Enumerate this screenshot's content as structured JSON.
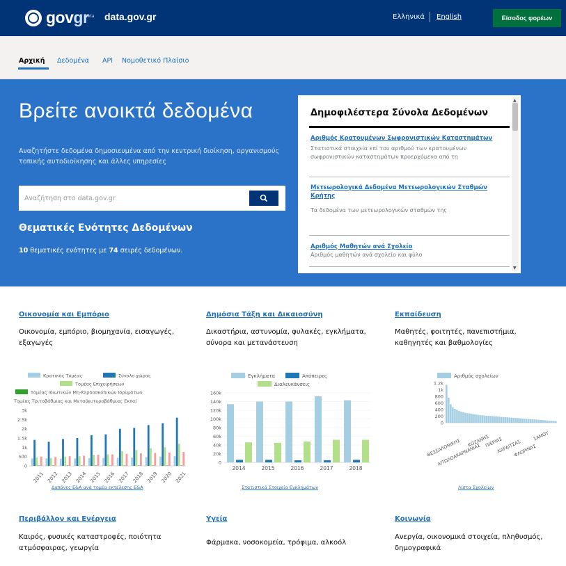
{
  "header": {
    "logo_text": "gov",
    "logo_text_accent": "gr",
    "logo_beta": "beta",
    "site_name": "data.gov.gr",
    "lang_el": "Ελληνικά",
    "lang_en": "English",
    "login_label": "Είσοδος φορέων",
    "colors": {
      "bar": "#003476",
      "login": "#00703c"
    }
  },
  "nav": {
    "items": [
      {
        "label": "Αρχική",
        "active": true
      },
      {
        "label": "Δεδομένα",
        "active": false
      },
      {
        "label": "API",
        "active": false
      },
      {
        "label": "Νομοθετικό Πλαίσιο",
        "active": false
      }
    ]
  },
  "hero": {
    "title": "Βρείτε ανοικτά δεδομένα",
    "description": "Αναζητήστε δεδομένα δημοσιευμένα από την κεντρική διοίκηση, οργανισμούς τοπικής αυτοδιοίκησης και άλλες υπηρεσίες",
    "search_placeholder": "Αναζήτηση στο data.gov.gr",
    "search_icon": "search-icon",
    "themes_title": "Θεματικές Ενότητες Δεδομένων",
    "themes_count": "10",
    "themes_text_1": "θεματικές ενότητες με",
    "series_count": "74",
    "themes_text_2": "σειρές δεδομένων.",
    "color": "#2b72c9"
  },
  "popular": {
    "title": "Δημοφιλέστερα Σύνολα Δεδομένων",
    "items": [
      {
        "title": "Αριθμός Κρατουμένων Σωφρονιστικών Καταστημάτων",
        "desc": "Στατιστικά στοιχεία επί του αριθμού των κρατουμένων σωφρονιστικών καταστημάτων προερχόμενα από τη"
      },
      {
        "title": "Μετεωρολογικά Δεδομένα Μετεωρολογικών Σταθμών Κρήτης",
        "desc": "Τα δεδομένα των μετεωρολογικών σταθμών της"
      },
      {
        "title": "Αριθμός Μαθητών ανά Σχολείο",
        "desc": "Αριθμός μαθητών ανά σχολείο και φύλο"
      }
    ]
  },
  "categories": [
    {
      "title": "Οικονομία και Εμπόριο",
      "desc": "Οικονομία, εμπόριο, βιομηχανία, εισαγωγές, εξαγωγές",
      "chart_link": "Δαπάνες Ε&Α ανά τομέα εκτέλεσης Ε&Α"
    },
    {
      "title": "Δημόσια Τάξη και Δικαιοσύνη",
      "desc": "Δικαστήρια, αστυνομία, φυλακές, εγκλήματα, σύνορα και μετανάστευση",
      "chart_link": "Στατιστικά Στοιχεία Εγκλημάτων"
    },
    {
      "title": "Εκπαίδευση",
      "desc": "Μαθητές, φοιτητές, πανεπιστήμια, καθηγητές και βαθμολογίες",
      "chart_link": "Λίστα Σχολείων"
    },
    {
      "title": "Περιβάλλον και Ενέργεια",
      "desc": "Καιρός, φυσικές καταστροφές, ποιότητα ατμόσφαιρας, γεωργία"
    },
    {
      "title": "Υγεία",
      "desc": "Φάρμακα, νοσοκομεία, τρόφιμα, αλκοόλ"
    },
    {
      "title": "Κοινωνία",
      "desc": "Ανεργία, οικονομικά στοιχεία, πληθυσμός, δημογραφικά"
    }
  ],
  "chart_data": [
    {
      "type": "bar",
      "legend": [
        "Κρατικός Τομέας",
        "Σύνολο χώρας",
        "Τομέας Επιχειρήσεων",
        "Τομέας Ιδιωτικών Μη-Κερδοσκοπικών Ιδρυμάτων",
        "Τομέας Τριτοβάθμιας και Μεταδευτεροβάθμιας Εκπαί"
      ],
      "categories": [
        "2011",
        "2012",
        "2013",
        "2014",
        "2015",
        "2016",
        "2017",
        "2018",
        "2019",
        "2020",
        "2021"
      ],
      "ytick_labels": [
        "3k",
        "2.5k",
        "2k",
        "1.5k",
        "1k",
        "500",
        "0"
      ],
      "ylim": [
        0,
        3000
      ],
      "series": [
        {
          "name": "Κρατικός Τομέας",
          "color": "#a6cee3",
          "values": [
            400,
            400,
            390,
            400,
            420,
            430,
            440,
            450,
            470,
            500,
            520
          ]
        },
        {
          "name": "Σύνολο χώρας",
          "color": "#1f78b4",
          "values": [
            1400,
            1300,
            1450,
            1500,
            1650,
            1700,
            2000,
            2050,
            2200,
            2300,
            2600
          ]
        },
        {
          "name": "Τομέας Επιχειρήσεων",
          "color": "#b2df8a",
          "values": [
            450,
            420,
            500,
            520,
            600,
            620,
            800,
            850,
            950,
            1000,
            1200
          ]
        },
        {
          "name": "Τομέας Ιδιωτικών Μη-Κερδοσκοπικών Ιδρυμάτων",
          "color": "#33a02c",
          "values": [
            20,
            20,
            20,
            20,
            20,
            20,
            20,
            20,
            20,
            20,
            20
          ]
        },
        {
          "name": "Τομέας Τριτοβάθμιας και Μεταδευτεροβάθμιας Εκπαί",
          "color": "#fb9a99",
          "values": [
            500,
            480,
            520,
            550,
            600,
            620,
            650,
            680,
            700,
            720,
            750
          ]
        }
      ]
    },
    {
      "type": "bar",
      "legend": [
        "Εγκλήματα",
        "Απόπειρες",
        "Διαλευκάνσεις"
      ],
      "categories": [
        "2014",
        "2015",
        "2016",
        "2017",
        "2018"
      ],
      "ytick_labels": [
        "160k",
        "140k",
        "120k",
        "100k",
        "80k",
        "60k",
        "40k",
        "20k",
        "0"
      ],
      "ylim": [
        0,
        160000
      ],
      "series": [
        {
          "name": "Εγκλήματα",
          "color": "#a6cee3",
          "values": [
            134000,
            140000,
            140000,
            152000,
            143000
          ]
        },
        {
          "name": "Απόπειρες",
          "color": "#1f78b4",
          "values": [
            6000,
            6000,
            5000,
            5000,
            6000
          ]
        },
        {
          "name": "Διαλευκάνσεις",
          "color": "#b2df8a",
          "values": [
            46000,
            45000,
            48000,
            52000,
            52000
          ]
        }
      ]
    },
    {
      "type": "bar",
      "legend": [
        "Αριθμός σχολείων"
      ],
      "ytick_labels": [
        "1.2k",
        "1k",
        "800",
        "600",
        "400",
        "200",
        "0"
      ],
      "ylim": [
        0,
        1200
      ],
      "category_labels": [
        "ΘΕΣΣΑΛΟΝΙΚΗΣ",
        "ΑΙΤΩΛΟΑΚΑΡΝΑΝΙΑΣ",
        "ΚΟΖΑΝΗΣ",
        "ΠΙΕΡΙΑΣ",
        "ΚΑΡΔΙΤΣΑΣ",
        "ΦΛΩΡΙΝΑΣ",
        "ΣΑΜΟΥ"
      ],
      "series": [
        {
          "name": "Αριθμός σχολείων",
          "color": "#a6cee3",
          "values": [
            1150,
            760,
            560,
            470,
            420,
            390,
            360,
            340,
            320,
            300,
            290,
            280,
            270,
            260,
            250,
            240,
            230,
            225,
            220,
            215,
            210,
            205,
            200,
            195,
            190,
            185,
            180,
            175,
            170,
            165,
            160,
            155,
            150,
            145,
            140,
            135,
            130,
            125,
            120,
            115,
            110,
            105,
            100,
            95,
            90,
            85,
            80,
            75,
            70,
            65,
            60,
            55,
            50
          ]
        }
      ]
    }
  ]
}
